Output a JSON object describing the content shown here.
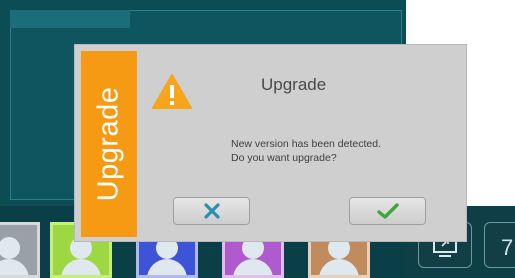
{
  "dialog": {
    "side_label": "Upgrade",
    "title": "Upgrade",
    "message_line1": "New version has been detected.",
    "message_line2": "Do you want upgrade?",
    "cancel_icon": "close-icon",
    "confirm_icon": "checkmark-icon",
    "accent_color": "#f79a13"
  },
  "toolbar": {
    "page_number": "7",
    "screen_icon": "screen-share-icon"
  },
  "thumbnails": [
    {
      "color": "#9aa0a8"
    },
    {
      "color": "#9dd843"
    },
    {
      "color": "#3d54d8"
    },
    {
      "color": "#b05ad0"
    },
    {
      "color": "#c08c5e"
    }
  ]
}
